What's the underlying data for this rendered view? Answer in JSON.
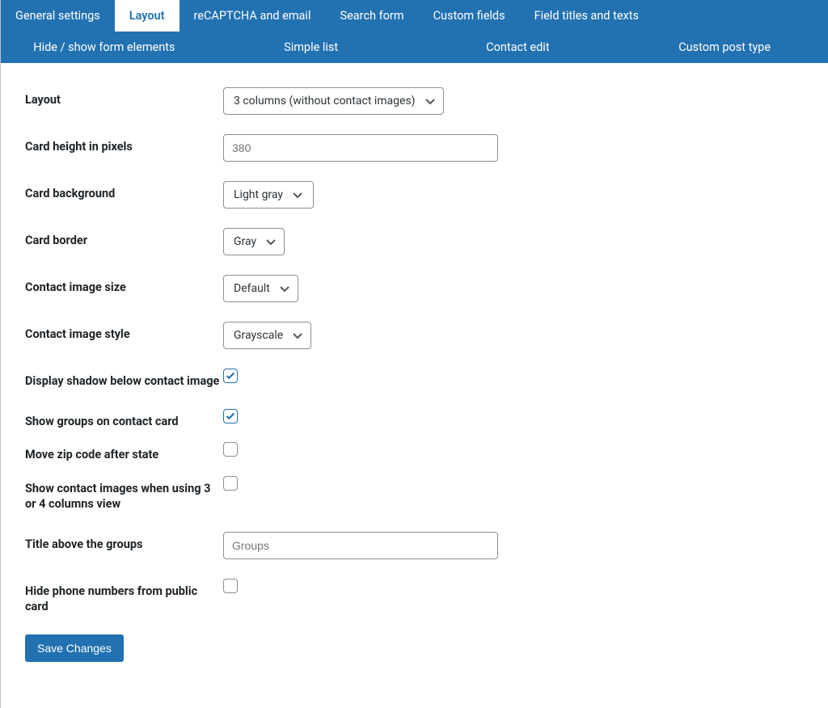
{
  "tabs": {
    "row1": [
      {
        "label": "General settings",
        "active": false
      },
      {
        "label": "Layout",
        "active": true
      },
      {
        "label": "reCAPTCHA and email",
        "active": false
      },
      {
        "label": "Search form",
        "active": false
      },
      {
        "label": "Custom fields",
        "active": false
      },
      {
        "label": "Field titles and texts",
        "active": false
      }
    ],
    "row2": [
      {
        "label": "Hide / show form elements"
      },
      {
        "label": "Simple list"
      },
      {
        "label": "Contact edit"
      },
      {
        "label": "Custom post type"
      }
    ]
  },
  "form": {
    "layout": {
      "label": "Layout",
      "value": "3 columns (without contact images)"
    },
    "card_height": {
      "label": "Card height in pixels",
      "placeholder": "380"
    },
    "card_bg": {
      "label": "Card background",
      "value": "Light gray"
    },
    "card_border": {
      "label": "Card border",
      "value": "Gray"
    },
    "img_size": {
      "label": "Contact image size",
      "value": "Default"
    },
    "img_style": {
      "label": "Contact image style",
      "value": "Grayscale"
    },
    "shadow": {
      "label": "Display shadow below contact image",
      "checked": true
    },
    "show_groups": {
      "label": "Show groups on contact card",
      "checked": true
    },
    "zip_after": {
      "label": "Move zip code after state",
      "checked": false
    },
    "images_34": {
      "label": "Show contact images when using 3 or 4 columns view",
      "checked": false
    },
    "groups_title": {
      "label": "Title above the groups",
      "placeholder": "Groups"
    },
    "hide_phone": {
      "label": "Hide phone numbers from public card",
      "checked": false
    }
  },
  "submit": {
    "label": "Save Changes"
  }
}
